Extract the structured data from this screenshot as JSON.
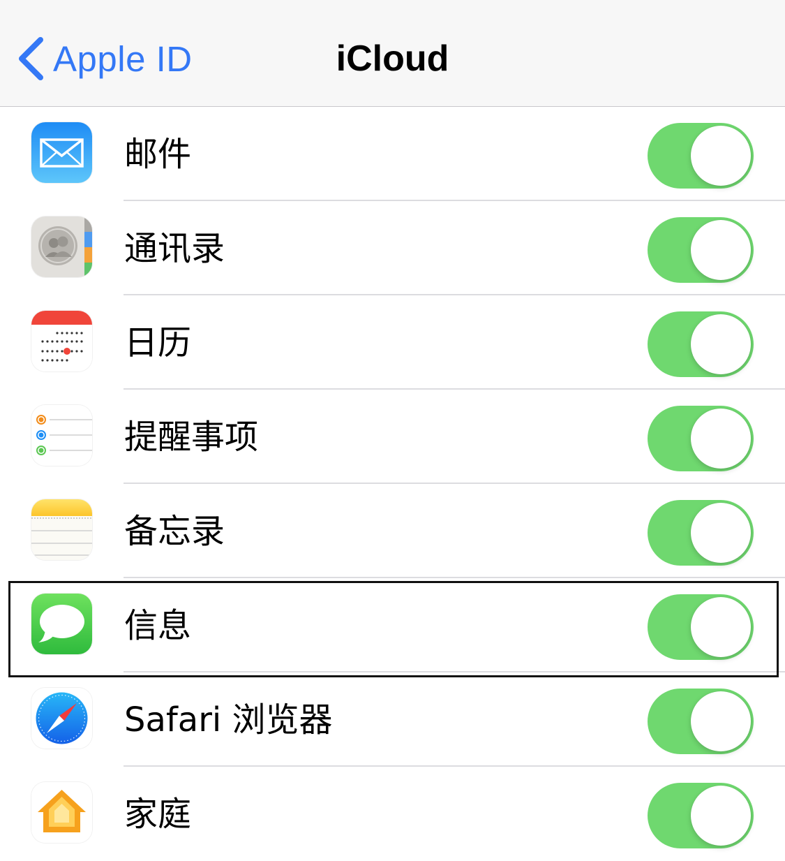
{
  "navbar": {
    "back_label": "Apple ID",
    "title": "iCloud"
  },
  "items": [
    {
      "label": "邮件",
      "icon": "mail-icon",
      "enabled": true
    },
    {
      "label": "通讯录",
      "icon": "contacts-icon",
      "enabled": true
    },
    {
      "label": "日历",
      "icon": "calendar-icon",
      "enabled": true
    },
    {
      "label": "提醒事项",
      "icon": "reminders-icon",
      "enabled": true
    },
    {
      "label": "备忘录",
      "icon": "notes-icon",
      "enabled": true
    },
    {
      "label": "信息",
      "icon": "messages-icon",
      "enabled": true,
      "highlighted": true
    },
    {
      "label": "Safari 浏览器",
      "icon": "safari-icon",
      "enabled": true
    },
    {
      "label": "家庭",
      "icon": "home-icon",
      "enabled": true
    }
  ],
  "colors": {
    "accent": "#3478f6",
    "toggle_on": "#6fd86f",
    "toggle_off": "#e5e5ea",
    "navbar_bg": "#f7f7f7"
  }
}
